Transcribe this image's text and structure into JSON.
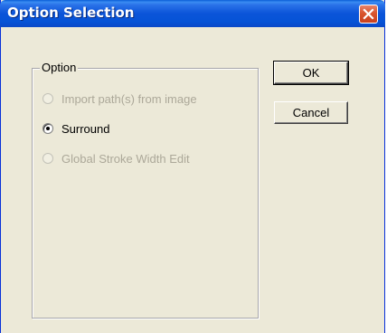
{
  "window": {
    "title": "Option Selection",
    "close_icon": "close-icon"
  },
  "group": {
    "label": "Option",
    "options": [
      {
        "label": "Import path(s) from image",
        "enabled": false,
        "selected": false
      },
      {
        "label": "Surround",
        "enabled": true,
        "selected": true
      },
      {
        "label": "Global Stroke Width Edit",
        "enabled": false,
        "selected": false
      }
    ]
  },
  "buttons": {
    "ok_label": "OK",
    "cancel_label": "Cancel"
  },
  "colors": {
    "titlebar": "#0b54d9",
    "dialog_bg": "#ece9d8",
    "close_button": "#d9552e",
    "disabled_text": "#aca899"
  }
}
